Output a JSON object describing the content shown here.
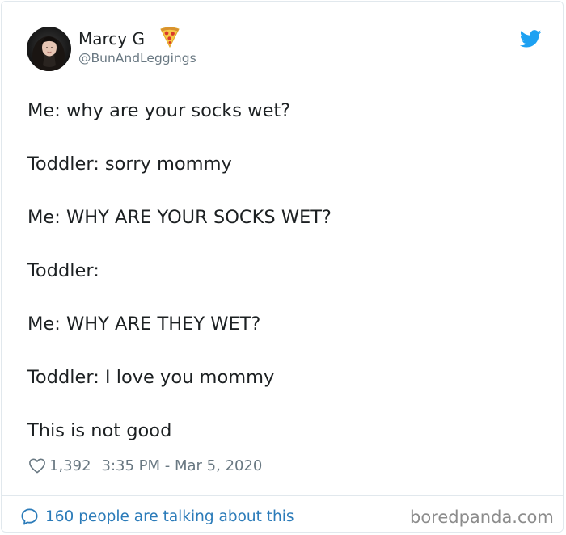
{
  "author": {
    "name": "Marcy G",
    "handle": "@BunAndLeggings"
  },
  "tweet_lines": [
    "Me: why are your socks wet?",
    "Toddler: sorry mommy",
    "Me: WHY ARE YOUR SOCKS WET?",
    "Toddler:",
    "Me: WHY ARE THEY WET?",
    "Toddler: I love you mommy",
    "This is not good"
  ],
  "meta": {
    "likes": "1,392",
    "timestamp": "3:35 PM - Mar 5, 2020"
  },
  "footer": {
    "talking_label": "160 people are talking about this"
  },
  "watermark": "boredpanda.com",
  "icons": {
    "brand": "twitter-bird-icon",
    "emoji": "pizza-icon",
    "like": "heart-icon",
    "reply": "speech-bubble-icon"
  },
  "colors": {
    "twitter_blue": "#1da1f2",
    "link_blue": "#2b7bb9",
    "secondary_text": "#697882",
    "primary_text": "#1c2022",
    "border": "#e1e8ed"
  }
}
